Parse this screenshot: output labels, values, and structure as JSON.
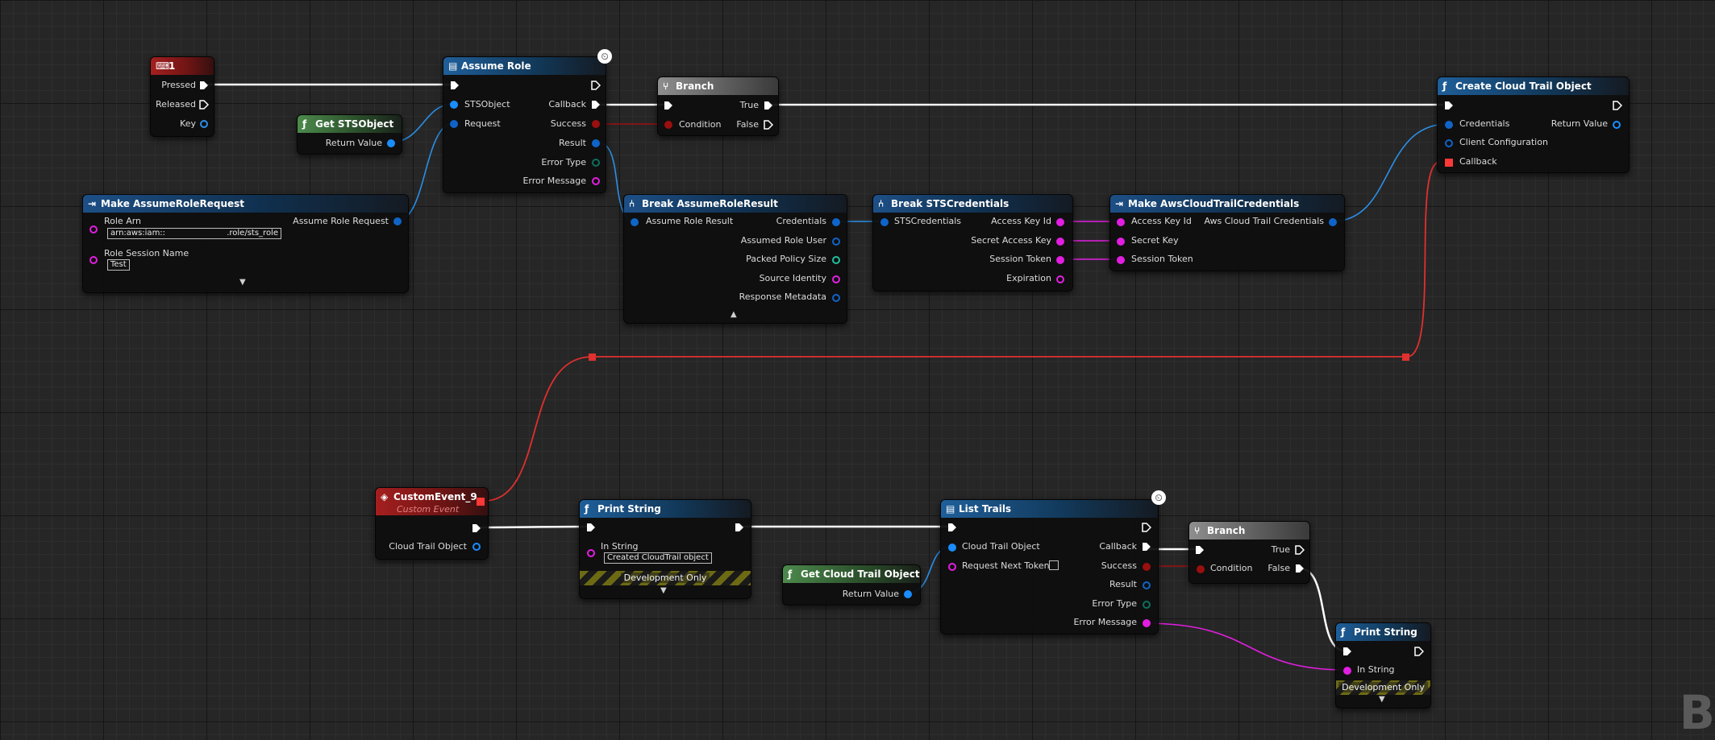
{
  "colors": {
    "exec": "#ffffff",
    "object": "#1a8dff",
    "string": "#e21ee1",
    "bool": "#9b0f0f",
    "struct": "#0f64c8",
    "enum": "#0e6f5e",
    "delegate": "#ff3838"
  },
  "icons": {
    "function": "function-icon",
    "break": "break-struct-icon",
    "make": "make-struct-icon",
    "branch": "branch-icon",
    "event": "custom-event-icon",
    "key": "keyboard-key-icon",
    "latent": "clock-icon"
  },
  "nodes": {
    "key1": {
      "title": "1",
      "pressed": "Pressed",
      "released": "Released",
      "key": "Key"
    },
    "get_sts": {
      "title": "Get STSObject",
      "return_value": "Return Value"
    },
    "assume_role": {
      "title": "Assume Role",
      "sts_object": "STSObject",
      "request": "Request",
      "callback": "Callback",
      "success": "Success",
      "result": "Result",
      "error_type": "Error Type",
      "error_message": "Error Message"
    },
    "make_request": {
      "title": "Make AssumeRoleRequest",
      "role_arn": "Role Arn",
      "role_arn_value": "arn:aws:iam::",
      "role_arn_suffix": ".role/sts_role",
      "role_session_name": "Role Session Name",
      "session_value": "Test",
      "output": "Assume Role Request"
    },
    "branch1": {
      "title": "Branch",
      "condition": "Condition",
      "true": "True",
      "false": "False"
    },
    "break_result": {
      "title": "Break AssumeRoleResult",
      "input": "Assume Role Result",
      "credentials": "Credentials",
      "assumed_role_user": "Assumed Role User",
      "packed_policy_size": "Packed Policy Size",
      "source_identity": "Source Identity",
      "response_metadata": "Response Metadata"
    },
    "break_creds": {
      "title": "Break STSCredentials",
      "input": "STSCredentials",
      "access_key_id": "Access Key Id",
      "secret_access_key": "Secret Access Key",
      "session_token": "Session Token",
      "expiration": "Expiration"
    },
    "make_ct_creds": {
      "title": "Make AwsCloudTrailCredentials",
      "access_key_id": "Access Key Id",
      "secret_key": "Secret Key",
      "session_token": "Session Token",
      "output": "Aws Cloud Trail Credentials"
    },
    "create_ct": {
      "title": "Create Cloud Trail Object",
      "credentials": "Credentials",
      "client_configuration": "Client Configuration",
      "callback": "Callback",
      "return_value": "Return Value"
    },
    "custom_event": {
      "title": "CustomEvent_9",
      "subtitle": "Custom Event",
      "cloud_trail_object": "Cloud Trail Object"
    },
    "print1": {
      "title": "Print String",
      "in_string": "In String",
      "in_string_value": "Created CloudTrail object",
      "dev_only": "Development Only"
    },
    "get_ct": {
      "title": "Get Cloud Trail Object",
      "return_value": "Return Value"
    },
    "list_trails": {
      "title": "List Trails",
      "cloud_trail_object": "Cloud Trail Object",
      "request_next_token": "Request Next Token",
      "callback": "Callback",
      "success": "Success",
      "result": "Result",
      "error_type": "Error Type",
      "error_message": "Error Message"
    },
    "branch2": {
      "title": "Branch",
      "condition": "Condition",
      "true": "True",
      "false": "False"
    },
    "print2": {
      "title": "Print String",
      "in_string": "In String",
      "dev_only": "Development Only"
    }
  },
  "corner_text": "B"
}
